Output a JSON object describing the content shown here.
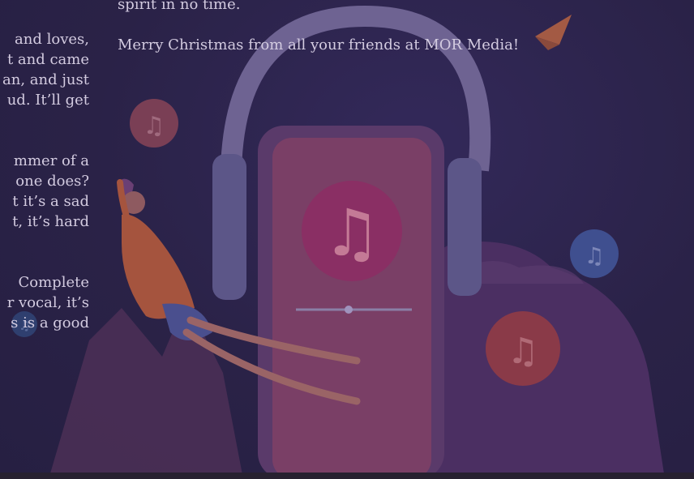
{
  "right_column": {
    "lines": [
      "spirit in no time.",
      "Merry Christmas from all your friends at MOR Media!"
    ]
  },
  "left_column": {
    "paragraphs": [
      [
        "and loves,",
        "t and came",
        "an, and just",
        "ud. It’ll get"
      ],
      [
        "mmer of a",
        "one does?",
        "t it’s a sad",
        "t, it’s hard"
      ],
      [
        "Complete",
        "r vocal, it’s",
        "s is a good"
      ]
    ]
  },
  "illustration": {
    "subject": "headphones-phone-music-notes",
    "colors": {
      "background": "#2a2247",
      "phone": "#7a3f66",
      "headband": "#6e6392",
      "accent_orange": "#9a4a4c",
      "accent_blue": "#4a4a8f"
    }
  }
}
